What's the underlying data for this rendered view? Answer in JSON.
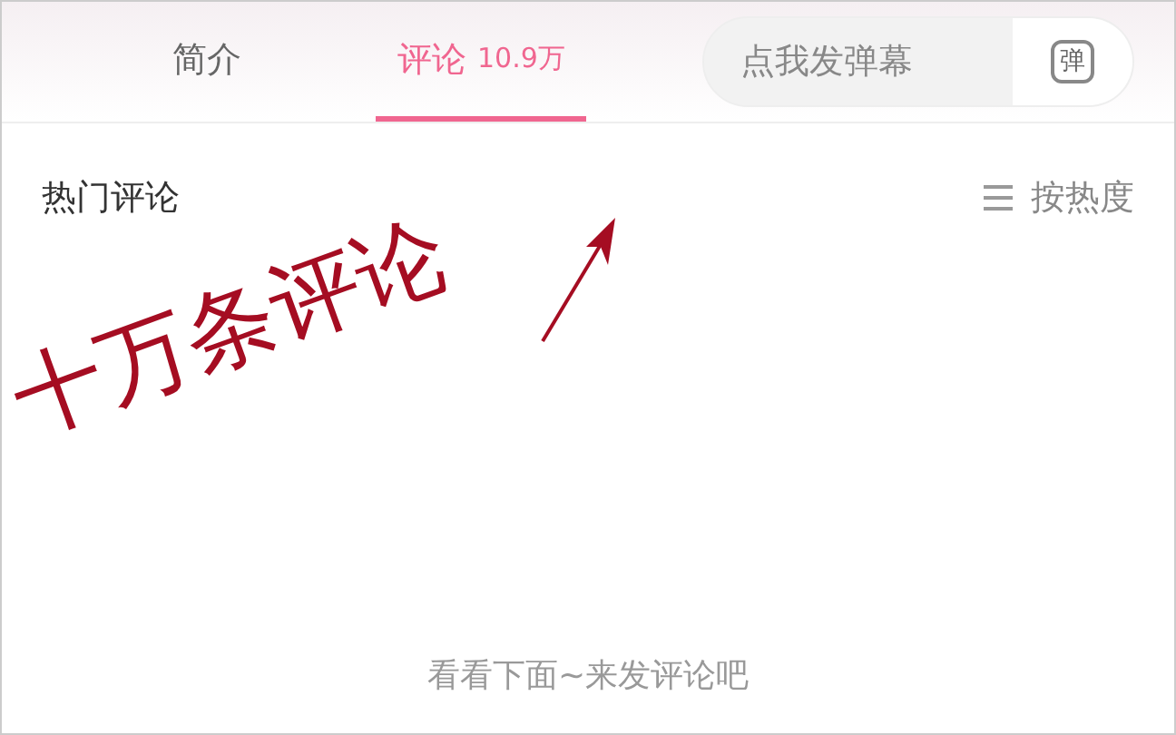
{
  "tabs": [
    {
      "label": "简介",
      "selected": false
    },
    {
      "label": "评论",
      "count": "10.9万",
      "selected": true
    }
  ],
  "danmaku": {
    "placeholder": "点我发弹幕",
    "button": "弹"
  },
  "comments": {
    "title": "热门评论",
    "sort": "按热度"
  },
  "annotation": {
    "text": "十万条评论"
  },
  "empty_hint": "看看下面~来发评论吧"
}
